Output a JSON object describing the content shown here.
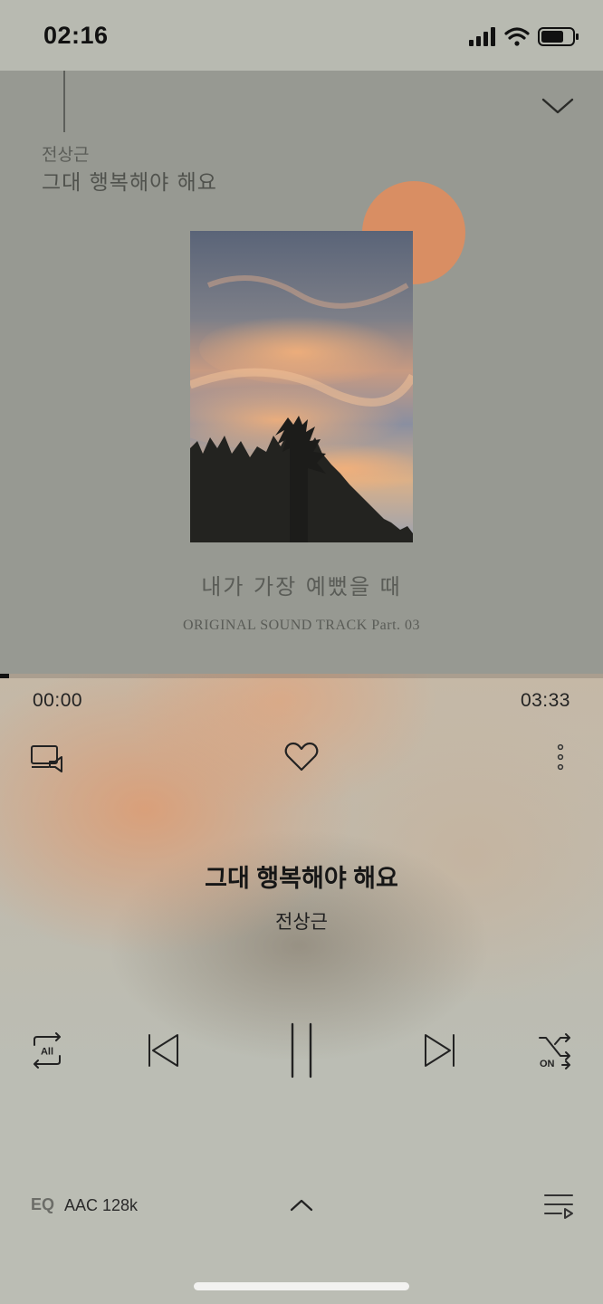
{
  "status_bar": {
    "time": "02:16",
    "icons": [
      "signal-icon",
      "wifi-icon",
      "battery-icon"
    ]
  },
  "cover": {
    "artist": "전상근",
    "title": "그대 행복해야 해요",
    "album_name": "내가 가장 예뻤을 때",
    "album_sub": "ORIGINAL SOUND TRACK Part. 03",
    "sun_color": "#d98e63"
  },
  "player": {
    "time_current": "00:00",
    "time_total": "03:33",
    "progress": 0.015,
    "song_title": "그대 행복해야 해요",
    "song_artist": "전상근",
    "repeat_label": "All",
    "shuffle_label": "ON",
    "eq_label": "EQ",
    "codec": "AAC 128k"
  },
  "icons": {
    "collapse": "chevron-down-icon",
    "cast": "cast-device-icon",
    "like": "heart-icon",
    "more": "more-vertical-icon",
    "repeat": "repeat-all-icon",
    "prev": "previous-track-icon",
    "pause": "pause-icon",
    "next": "next-track-icon",
    "shuffle": "shuffle-icon",
    "expand": "chevron-up-icon",
    "playlist": "playlist-icon"
  }
}
